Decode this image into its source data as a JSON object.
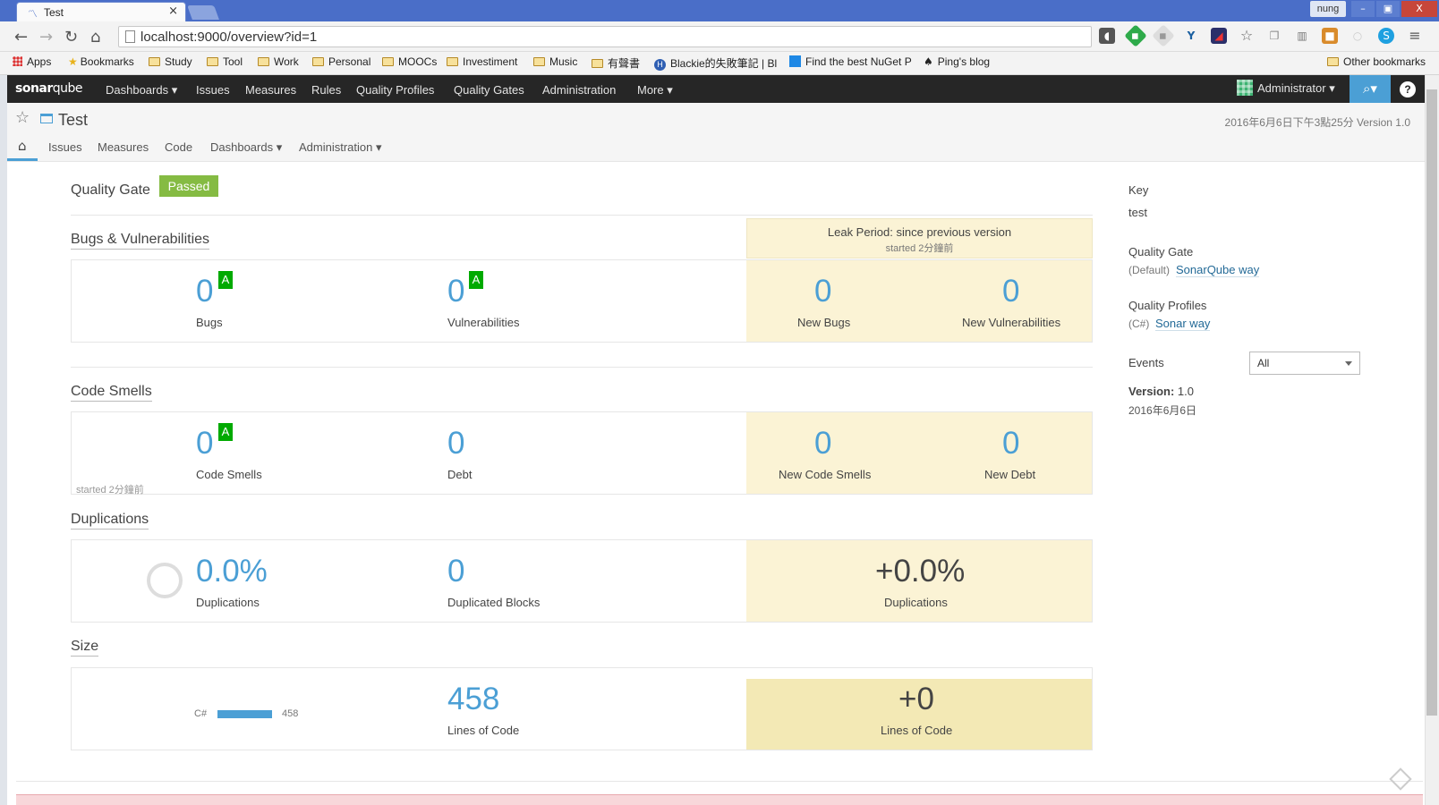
{
  "browser": {
    "tab_title": "Test",
    "tab_close": "×",
    "user": "nung",
    "win_min": "–",
    "win_max": "▣",
    "win_close": "X",
    "url": "localhost:9000/overview?id=1",
    "bookmarks": [
      "Apps",
      "Bookmarks",
      "Study",
      "Tool",
      "Work",
      "Personal",
      "MOOCs",
      "Investiment",
      "Music",
      "有聲書",
      "Blackie的失敗筆記 | Bl",
      "Find the best NuGet P",
      "Ping's blog"
    ],
    "other_bookmarks": "Other bookmarks"
  },
  "sonar_nav": {
    "logo_a": "sonar",
    "logo_b": "qube",
    "items": [
      "Dashboards ▾",
      "Issues",
      "Measures",
      "Rules",
      "Quality Profiles",
      "Quality Gates",
      "Administration",
      "More ▾"
    ],
    "user": "Administrator ▾",
    "help": "?"
  },
  "project": {
    "name": "Test",
    "meta": "2016年6月6日下午3點25分   Version 1.0",
    "nav": [
      "Issues",
      "Measures",
      "Code",
      "Dashboards ▾",
      "Administration ▾"
    ]
  },
  "quality_gate": {
    "label": "Quality Gate",
    "status": "Passed"
  },
  "leak": {
    "title": "Leak Period: since previous version",
    "started": "started 2分鐘前"
  },
  "bugs": {
    "title": "Bugs & Vulnerabilities",
    "bugs_value": "0",
    "bugs_rating": "A",
    "bugs_label": "Bugs",
    "vuln_value": "0",
    "vuln_rating": "A",
    "vuln_label": "Vulnerabilities",
    "new_bugs_value": "0",
    "new_bugs_label": "New Bugs",
    "new_vuln_value": "0",
    "new_vuln_label": "New Vulnerabilities"
  },
  "smells": {
    "title": "Code Smells",
    "value": "0",
    "rating": "A",
    "label": "Code Smells",
    "debt_value": "0",
    "debt_label": "Debt",
    "started": "started 2分鐘前",
    "new_value": "0",
    "new_label": "New Code Smells",
    "new_debt_value": "0",
    "new_debt_label": "New Debt"
  },
  "duplications": {
    "title": "Duplications",
    "value": "0.0%",
    "label": "Duplications",
    "blocks_value": "0",
    "blocks_label": "Duplicated Blocks",
    "new_value": "+0.0%",
    "new_label": "Duplications"
  },
  "size": {
    "title": "Size",
    "lang": "C#",
    "lang_count": "458",
    "loc_value": "458",
    "loc_label": "Lines of Code",
    "new_value": "+0",
    "new_label": "Lines of Code"
  },
  "sidebar": {
    "key_label": "Key",
    "key_value": "test",
    "qg_label": "Quality Gate",
    "qg_prefix": "(Default)",
    "qg_link": "SonarQube way",
    "qp_label": "Quality Profiles",
    "qp_prefix": "(C#)",
    "qp_link": "Sonar way",
    "events_label": "Events",
    "events_filter": "All",
    "event_version_label": "Version:",
    "event_version": "1.0",
    "event_date": "2016年6月6日"
  },
  "colors": {
    "accent": "#4b9fd5",
    "passed": "#85bb43",
    "rating_a": "#00aa00",
    "leak_bg": "#fbf3d5",
    "nav_bg": "#262626"
  }
}
